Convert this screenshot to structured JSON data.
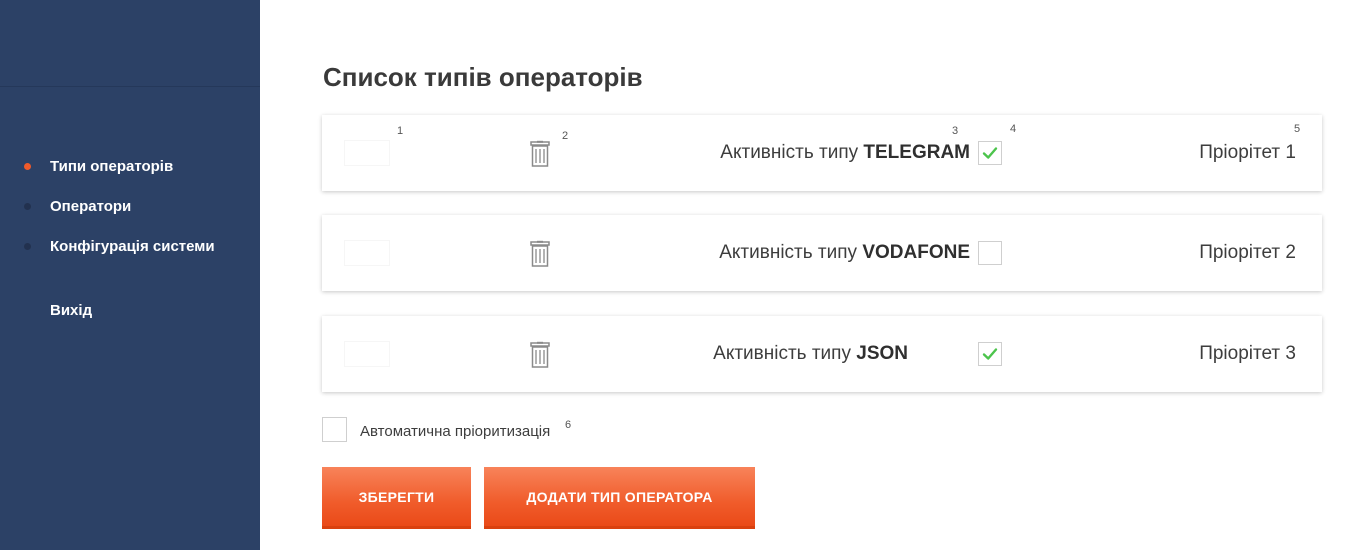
{
  "sidebar": {
    "items": [
      {
        "label": "Типи операторів",
        "active": true
      },
      {
        "label": "Оператори",
        "active": false
      },
      {
        "label": "Конфігурація системи",
        "active": false
      }
    ],
    "logout_label": "Вихід"
  },
  "main": {
    "title": "Список типів операторів",
    "activity_label": "Активність типу",
    "priority_label": "Пріорітет",
    "operators": [
      {
        "type": "TELEGRAM",
        "active": true,
        "priority": "1"
      },
      {
        "type": "VODAFONE",
        "active": false,
        "priority": "2"
      },
      {
        "type": "JSON",
        "active": true,
        "priority": "3"
      }
    ],
    "markers": [
      "1",
      "2",
      "3",
      "4",
      "5",
      "6"
    ],
    "auto_prioritization": {
      "label": "Автоматична пріоритизація",
      "checked": false
    },
    "buttons": {
      "save": "ЗБЕРЕГТИ",
      "add": "ДОДАТИ ТИП ОПЕРАТОРА"
    }
  },
  "colors": {
    "sidebar_bg": "#2c4166",
    "accent": "#f05a2a",
    "check_green": "#4cc44c"
  }
}
